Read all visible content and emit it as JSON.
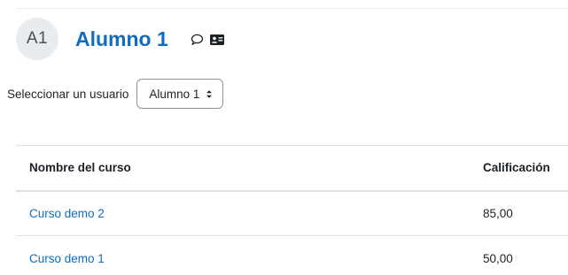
{
  "user": {
    "initials": "A1",
    "name": "Alumno 1",
    "icons": [
      "message-icon",
      "address-card-icon"
    ]
  },
  "selector": {
    "label": "Seleccionar un usuario",
    "selected": "Alumno 1"
  },
  "table": {
    "headers": {
      "course": "Nombre del curso",
      "grade": "Calificación"
    },
    "rows": [
      {
        "course": "Curso demo 2",
        "grade": "85,00"
      },
      {
        "course": "Curso demo 1",
        "grade": "50,00"
      }
    ]
  },
  "colors": {
    "link": "#0f6cbf",
    "text": "#1d2125",
    "avatar_bg": "#e9ecef"
  }
}
